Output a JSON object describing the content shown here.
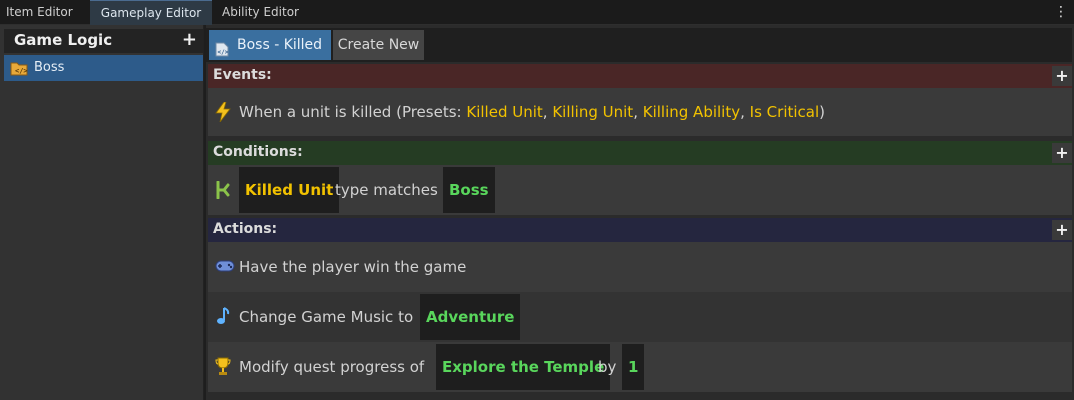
{
  "tabs": [
    {
      "label": "Item Editor"
    },
    {
      "label": "Gameplay Editor"
    },
    {
      "label": "Ability Editor"
    }
  ],
  "tab_menu_icon": "kebab-menu-icon",
  "sidebar": {
    "title": "Game Logic",
    "add_icon": "plus-icon",
    "items": [
      {
        "label": "Boss",
        "icon": "script-folder-icon"
      }
    ]
  },
  "toolbar": {
    "active_label": "Boss - Killed",
    "create_label": "Create New"
  },
  "events": {
    "title": "Events:",
    "color": "#4a2626",
    "text": "When a unit is killed (Presets:",
    "presets": [
      "Killed Unit",
      "Killing Unit",
      "Killing Ability",
      "Is Critical"
    ],
    "sep": ",",
    "close": ")"
  },
  "conditions": {
    "title": "Conditions:",
    "color": "#253c23",
    "chip1": "Killed Unit",
    "mid": "type matches",
    "chip2": "Boss"
  },
  "actions": {
    "title": "Actions:",
    "color": "#25263f",
    "win": "Have the player win the game",
    "music_text": "Change Game Music to",
    "music_value": "Adventure",
    "quest_text": "Modify quest progress of",
    "quest_value": "Explore the Temple",
    "quest_by": "by",
    "quest_amount": "1"
  }
}
